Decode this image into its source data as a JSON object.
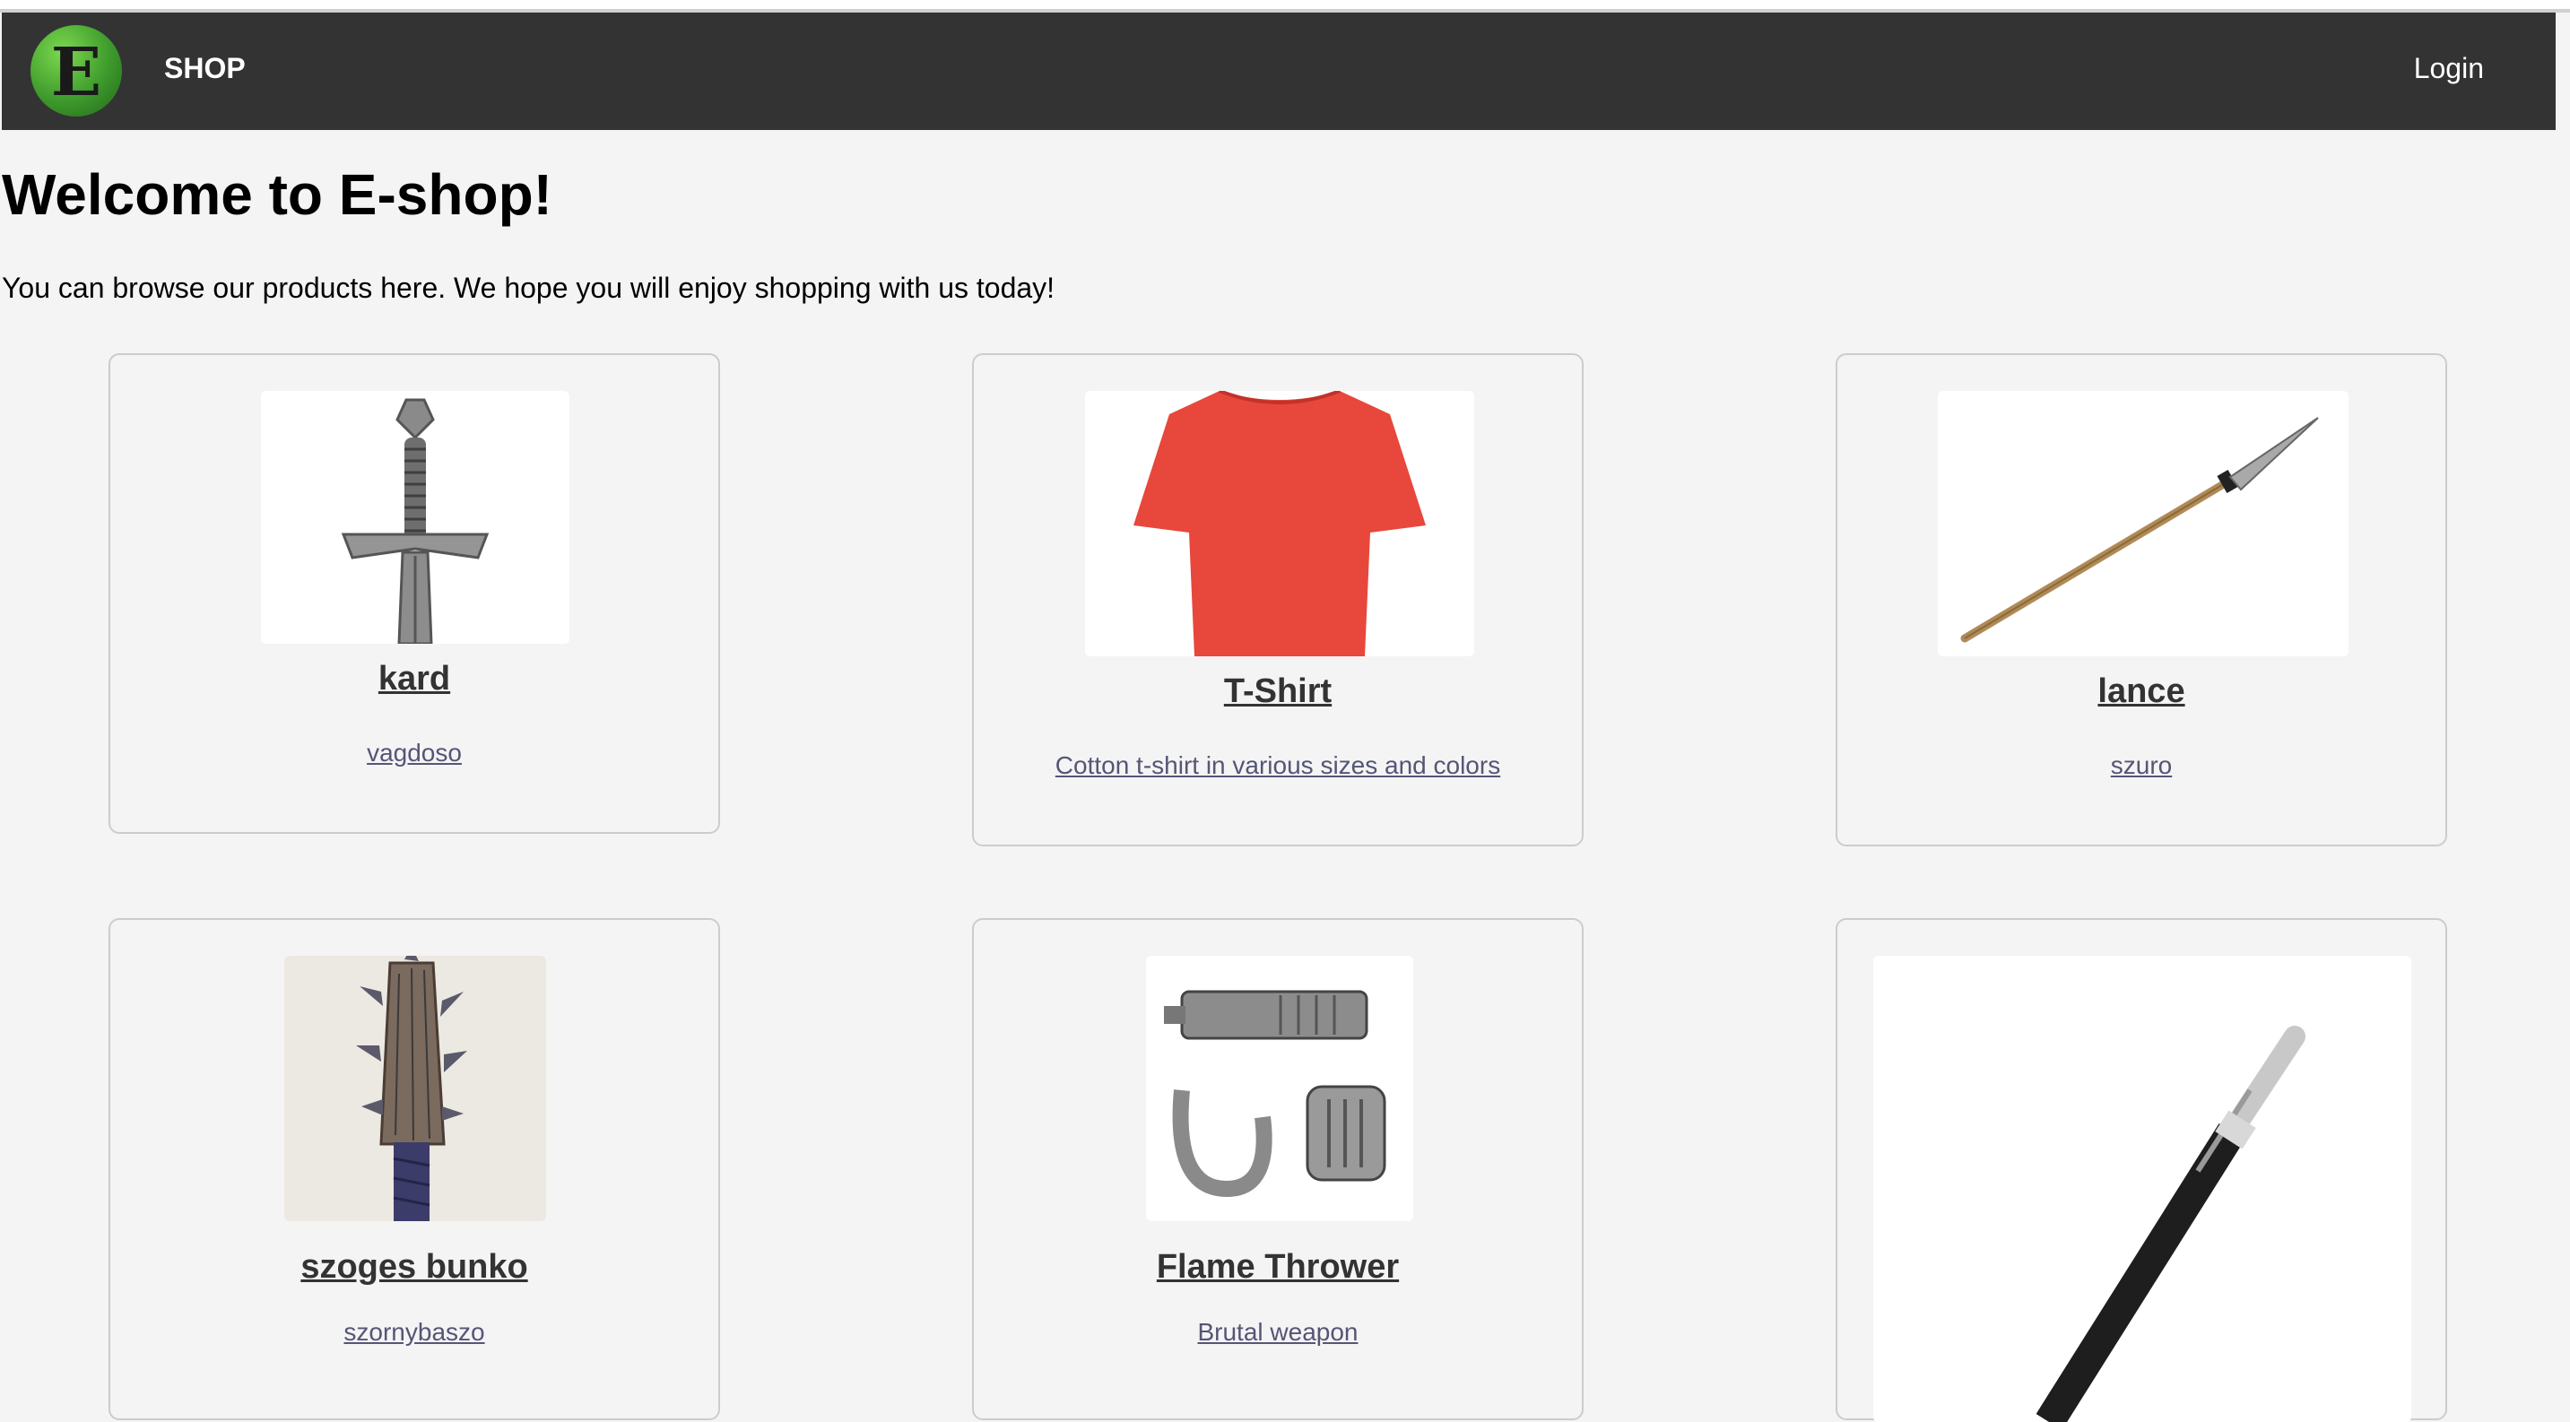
{
  "header": {
    "logo_letter": "E",
    "shop_label": "SHOP",
    "login_label": "Login"
  },
  "main": {
    "title": "Welcome to E-shop!",
    "intro": "You can browse our products here. We hope you will enjoy shopping with us today!"
  },
  "products": [
    {
      "name": "kard",
      "description": "vagdoso",
      "image": "sword-image"
    },
    {
      "name": "T-Shirt",
      "description": "Cotton t-shirt in various sizes and colors",
      "image": "tshirt-image"
    },
    {
      "name": "lance",
      "description": "szuro",
      "image": "lance-image"
    },
    {
      "name": "szoges bunko",
      "description": "szornybaszo",
      "image": "spiked-club-image"
    },
    {
      "name": "Flame Thrower",
      "description": "Brutal weapon",
      "image": "flame-thrower-image"
    },
    {
      "name": "",
      "description": "",
      "image": "pen-image"
    }
  ],
  "colors": {
    "navbar": "#333333",
    "background": "#f4f4f4",
    "logo_green": "#3e9a2c",
    "tshirt_red": "#e8473c"
  }
}
